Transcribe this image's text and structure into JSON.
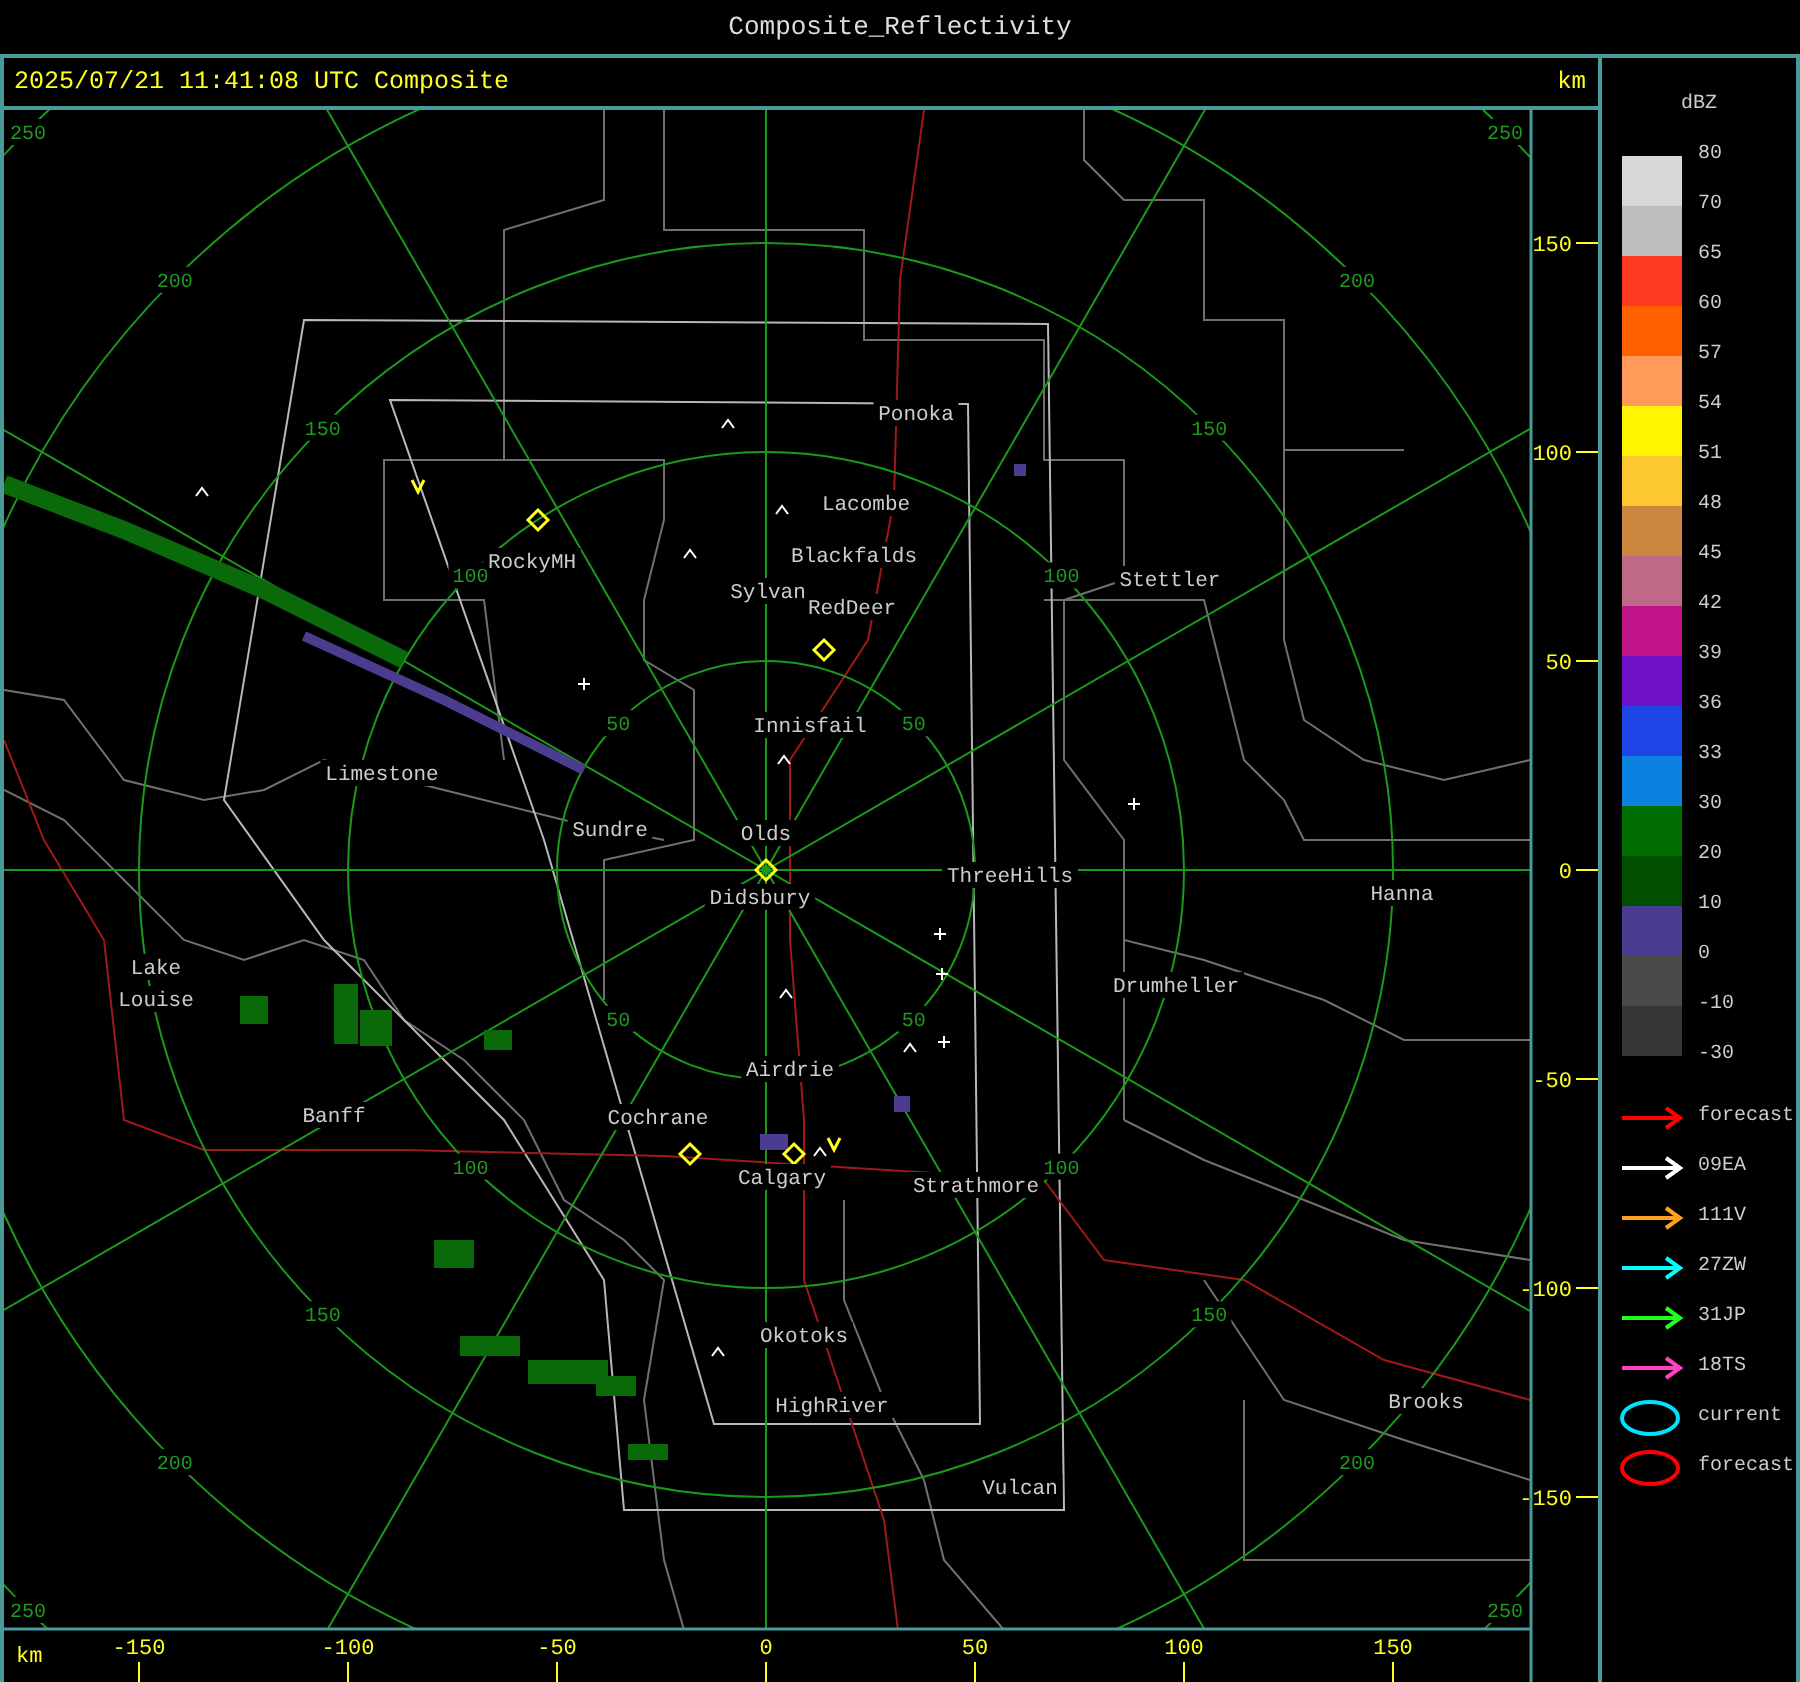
{
  "window": {
    "title": "Composite_Reflectivity"
  },
  "header": {
    "timestamp": "2025/07/21 11:41:08 UTC Composite",
    "unit": "km"
  },
  "map": {
    "range_rings": [
      {
        "labels": [
          "50",
          "50",
          "50",
          "50"
        ]
      },
      {
        "labels": [
          "100",
          "100",
          "100",
          "100"
        ]
      },
      {
        "labels": [
          "150",
          "150",
          "150",
          "150"
        ]
      },
      {
        "labels": [
          "200",
          "200",
          "200",
          "200"
        ]
      },
      {
        "labels": [
          "250",
          "250",
          "250",
          "250"
        ]
      }
    ],
    "cities": [
      "Ponoka",
      "Lacombe",
      "Blackfalds",
      "Sylvan",
      "RedDeer",
      "RockyMH",
      "Stettler",
      "Innisfail",
      "Limestone",
      "Sundre",
      "Olds",
      "ThreeHills",
      "Didsbury",
      "Hanna",
      "Lake Louise",
      "Drumheller",
      "Airdrie",
      "Banff",
      "Cochrane",
      "Calgary",
      "Strathmore",
      "Okotoks",
      "Brooks",
      "HighRiver",
      "Vulcan"
    ]
  },
  "y_axis": {
    "ticks": [
      "150",
      "100",
      "50",
      "0",
      "-50",
      "-100",
      "-150"
    ]
  },
  "x_axis": {
    "unit": "km",
    "ticks": [
      "-150",
      "-100",
      "-50",
      "0",
      "50",
      "100",
      "150"
    ]
  },
  "legend": {
    "title": "dBZ",
    "scale": [
      {
        "label": "80",
        "color": "#d8d8d8"
      },
      {
        "label": "70",
        "color": "#bebebe"
      },
      {
        "label": "65",
        "color": "#ff3820"
      },
      {
        "label": "60",
        "color": "#ff6000"
      },
      {
        "label": "57",
        "color": "#ff9a5a"
      },
      {
        "label": "54",
        "color": "#fff500"
      },
      {
        "label": "51",
        "color": "#fcc832"
      },
      {
        "label": "48",
        "color": "#cc8640"
      },
      {
        "label": "45",
        "color": "#c06888"
      },
      {
        "label": "42",
        "color": "#c01488"
      },
      {
        "label": "39",
        "color": "#7010c8"
      },
      {
        "label": "36",
        "color": "#1e46e6"
      },
      {
        "label": "33",
        "color": "#0c82e0"
      },
      {
        "label": "30",
        "color": "#006e00"
      },
      {
        "label": "20",
        "color": "#005000"
      },
      {
        "label": "10",
        "color": "#4c3c90"
      },
      {
        "label": "0",
        "color": "#4a4a4a"
      },
      {
        "label": "-10",
        "color": "#363636"
      }
    ],
    "scale_end": "-30",
    "tracks": [
      {
        "kind": "arrow",
        "label": "forecast",
        "color": "#ff0000"
      },
      {
        "kind": "arrow",
        "label": "09EA",
        "color": "#ffffff"
      },
      {
        "kind": "arrow",
        "label": "111V",
        "color": "#ffa020"
      },
      {
        "kind": "arrow",
        "label": "27ZW",
        "color": "#00ffff"
      },
      {
        "kind": "arrow",
        "label": "31JP",
        "color": "#20ff20"
      },
      {
        "kind": "arrow",
        "label": "18TS",
        "color": "#ff40c0"
      },
      {
        "kind": "ellipse",
        "label": "current",
        "color": "#00e0ff"
      },
      {
        "kind": "ellipse",
        "label": "forecast",
        "color": "#ff0000"
      }
    ]
  }
}
